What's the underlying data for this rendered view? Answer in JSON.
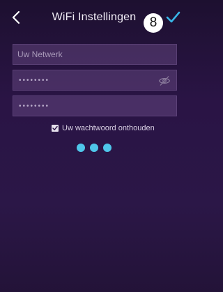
{
  "header": {
    "title": "WiFi Instellingen",
    "step_number": "8",
    "back_icon": "chevron-left-icon",
    "confirm_icon": "checkmark-icon",
    "confirm_color": "#38b6e8"
  },
  "form": {
    "network": {
      "placeholder": "Uw Netwerk",
      "value": ""
    },
    "password": {
      "masked_value": "••••••••"
    },
    "password_confirm": {
      "masked_value": "••••••••"
    },
    "toggle_visibility_icon": "eye-slash-icon",
    "remember": {
      "label": "Uw wachtwoord onthouden",
      "checked": true
    }
  },
  "loader": {
    "dot_count": 3,
    "color": "#4fc6ea"
  }
}
